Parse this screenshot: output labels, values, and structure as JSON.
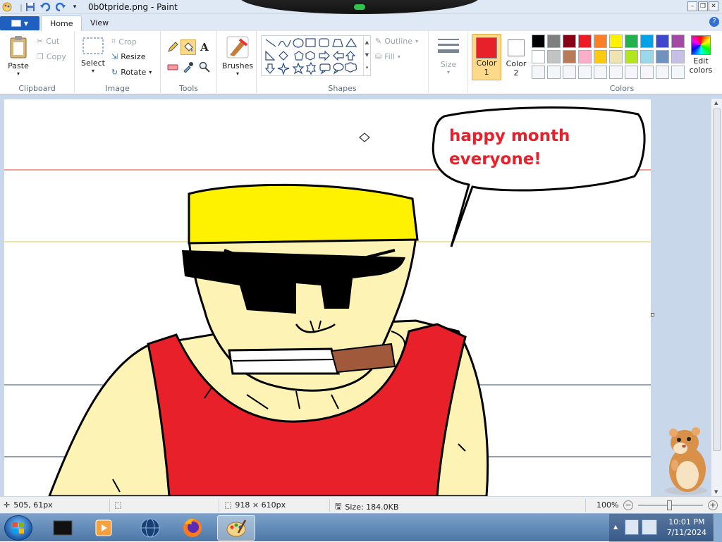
{
  "window": {
    "title": "0b0tpride.png - Paint"
  },
  "tabs": [
    {
      "label": "Home",
      "active": true
    },
    {
      "label": "View",
      "active": false
    }
  ],
  "ribbon": {
    "clipboard": {
      "label": "Clipboard",
      "paste": "Paste",
      "cut": "Cut",
      "copy": "Copy"
    },
    "image": {
      "label": "Image",
      "select": "Select",
      "crop": "Crop",
      "resize": "Resize",
      "rotate": "Rotate"
    },
    "tools": {
      "label": "Tools"
    },
    "brushes": {
      "label": "Brushes"
    },
    "shapes": {
      "label": "Shapes",
      "outline": "Outline",
      "fill": "Fill"
    },
    "size": {
      "label": "Size"
    },
    "color1": {
      "label": "Color",
      "num": "1",
      "value": "#e8202a"
    },
    "color2": {
      "label": "Color",
      "num": "2",
      "value": "#ffffff"
    },
    "colors": {
      "label": "Colors",
      "edit_line1": "Edit",
      "edit_line2": "colors",
      "palette": [
        "#000000",
        "#7f7f7f",
        "#880015",
        "#ed1c24",
        "#ff7f27",
        "#fff200",
        "#22b14c",
        "#00a2e8",
        "#3f48cc",
        "#a349a4",
        "#ffffff",
        "#c3c3c3",
        "#b97a57",
        "#ffaec9",
        "#ffc90e",
        "#efe4b0",
        "#b5e61d",
        "#99d9ea",
        "#7092be",
        "#c8bfe7"
      ]
    }
  },
  "drawing": {
    "speech_line1": "happy month",
    "speech_line2": "everyone!"
  },
  "status": {
    "cursor_pos": "505, 61px",
    "image_size": "918 × 610px",
    "file_size": "Size: 184.0KB",
    "zoom": "100%"
  },
  "taskbar": {
    "time": "10:01 PM",
    "date": "7/11/2024"
  }
}
